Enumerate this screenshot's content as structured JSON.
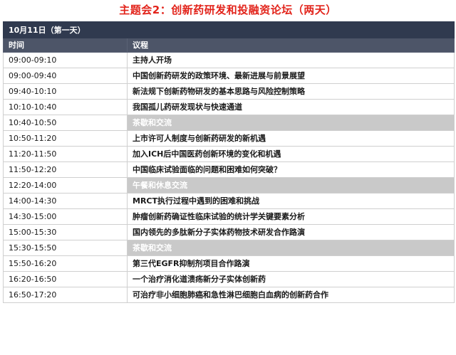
{
  "title": "主题会2：创新药研发和投融资论坛（两天）",
  "day_label": "10月11日（第一天）",
  "headers": {
    "time": "时间",
    "topic": "议程"
  },
  "rows": [
    {
      "time": "09:00-09:10",
      "topic": "主持人开场",
      "is_break": false
    },
    {
      "time": "09:00-09:40",
      "topic": "中国创新药研发的政策环境、最新进展与前景展望",
      "is_break": false
    },
    {
      "time": "09:40-10:10",
      "topic": "新法规下创新药物研发的基本思路与风险控制策略",
      "is_break": false
    },
    {
      "time": "10:10-10:40",
      "topic": "我国孤儿药研发现状与快速通道",
      "is_break": false
    },
    {
      "time": "10:40-10:50",
      "topic": "茶歇和交流",
      "is_break": true
    },
    {
      "time": "10:50-11:20",
      "topic": "上市许可人制度与创新药研发的新机遇",
      "is_break": false
    },
    {
      "time": "11:20-11:50",
      "topic": "加入ICH后中国医药创新环境的变化和机遇",
      "is_break": false
    },
    {
      "time": "11:50-12:20",
      "topic": "中国临床试验面临的问题和困难如何突破？",
      "is_break": false
    },
    {
      "time": "12:20-14:00",
      "topic": "午餐和休息交流",
      "is_break": true
    },
    {
      "time": "14:00-14:30",
      "topic": "MRCT执行过程中遇到的困难和挑战",
      "is_break": false
    },
    {
      "time": "14:30-15:00",
      "topic": "肿瘤创新药确证性临床试验的统计学关键要素分析",
      "is_break": false
    },
    {
      "time": "15:00-15:30",
      "topic": "国内领先的多肽新分子实体药物技术研发合作路演",
      "is_break": false
    },
    {
      "time": "15:30-15:50",
      "topic": "茶歇和交流",
      "is_break": true
    },
    {
      "time": "15:50-16:20",
      "topic": "第三代EGFR抑制剂项目合作路演",
      "is_break": false
    },
    {
      "time": "16:20-16:50",
      "topic": "一个治疗消化道溃疡新分子实体创新药",
      "is_break": false
    },
    {
      "time": "16:50-17:20",
      "topic": "可治疗非小细胞肺癌和急性淋巴细胞白血病的创新药合作",
      "is_break": false
    }
  ]
}
